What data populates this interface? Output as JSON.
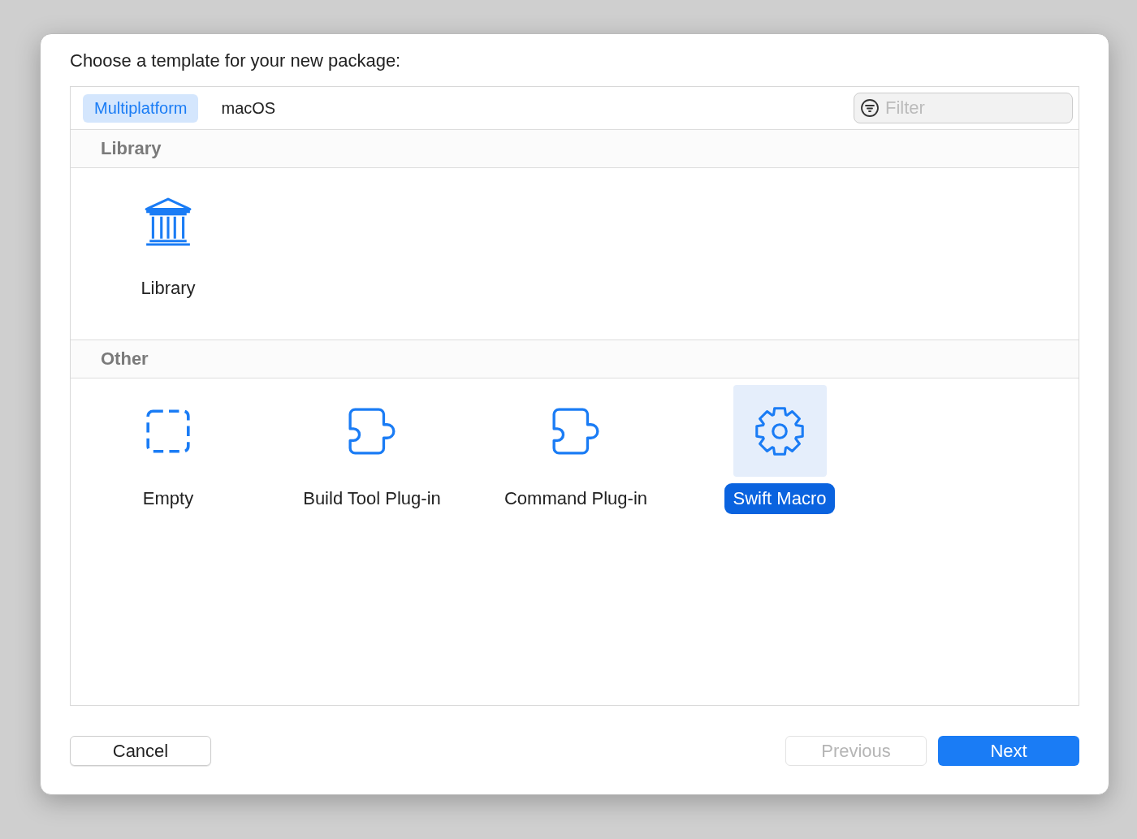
{
  "dialog": {
    "title": "Choose a template for your new package:"
  },
  "tabs": [
    {
      "label": "Multiplatform",
      "selected": true
    },
    {
      "label": "macOS",
      "selected": false
    }
  ],
  "filter": {
    "placeholder": "Filter"
  },
  "sections": [
    {
      "title": "Library",
      "templates": [
        {
          "kind": "library",
          "label": "Library",
          "selected": false
        }
      ]
    },
    {
      "title": "Other",
      "templates": [
        {
          "kind": "empty",
          "label": "Empty",
          "selected": false
        },
        {
          "kind": "plugin",
          "label": "Build Tool Plug-in",
          "selected": false
        },
        {
          "kind": "plugin",
          "label": "Command Plug-in",
          "selected": false
        },
        {
          "kind": "macro",
          "label": "Swift Macro",
          "selected": true
        }
      ]
    }
  ],
  "buttons": [
    {
      "label": "Cancel",
      "kind": "plain",
      "disabled": false
    },
    {
      "label": "Previous",
      "kind": "plain",
      "disabled": true
    },
    {
      "label": "Next",
      "kind": "default",
      "disabled": false
    }
  ]
}
